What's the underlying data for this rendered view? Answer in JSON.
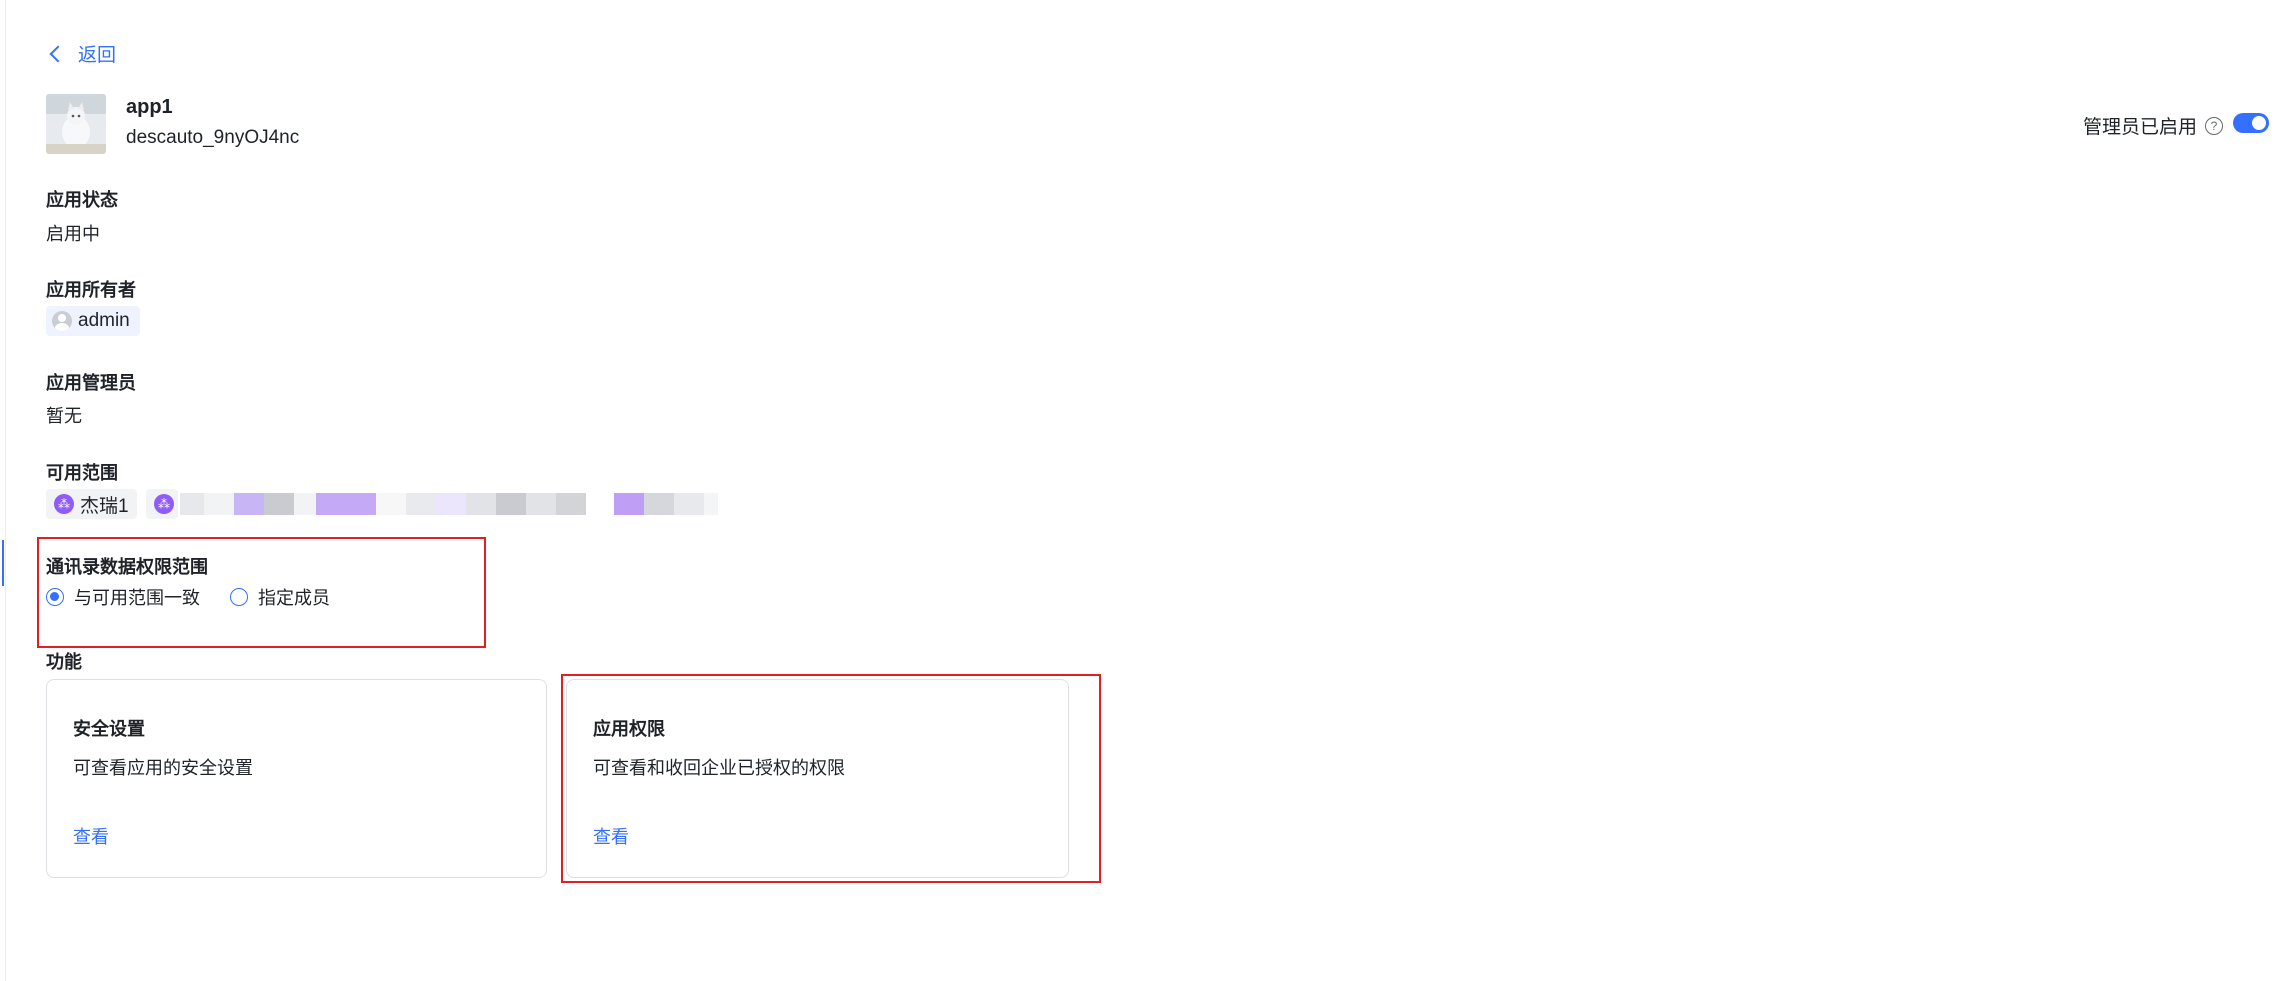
{
  "nav": {
    "back_label": "返回"
  },
  "app": {
    "name": "app1",
    "description": "descauto_9nyOJ4nc",
    "admin_enabled_label": "管理员已启用",
    "admin_enabled": true
  },
  "sections": {
    "status": {
      "label": "应用状态",
      "value": "启用中"
    },
    "owner": {
      "label": "应用所有者",
      "value": "admin"
    },
    "admins": {
      "label": "应用管理员",
      "value": "暂无"
    },
    "scope": {
      "label": "可用范围",
      "items": [
        "杰瑞1"
      ]
    },
    "contacts_scope": {
      "label": "通讯录数据权限范围",
      "options": [
        "与可用范围一致",
        "指定成员"
      ],
      "selected": "与可用范围一致"
    },
    "features": {
      "label": "功能",
      "cards": [
        {
          "title": "安全设置",
          "description": "可查看应用的安全设置",
          "link": "查看"
        },
        {
          "title": "应用权限",
          "description": "可查看和收回企业已授权的权限",
          "link": "查看"
        }
      ]
    }
  },
  "colors": {
    "accent": "#3370ff",
    "highlight": "#e02020",
    "org_icon": "#8f5cf7"
  }
}
